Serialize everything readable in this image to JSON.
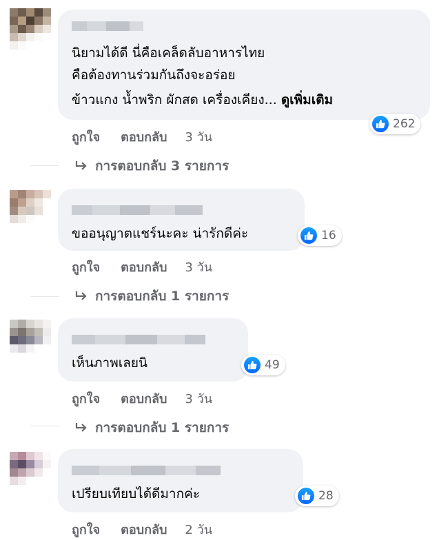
{
  "colors": {
    "bubble": "#f0f2f5",
    "like": "#0866ff",
    "meta": "#65676b"
  },
  "comments": [
    {
      "lines": [
        "นิยามได้ดี นี่คือเคล็ดลับอาหารไทย",
        "คือต้องทานร่วมกันถึงจะอร่อย",
        "ข้าวแกง น้ำพริก ผักสด เครื่องเคียง... "
      ],
      "see_more": "ดูเพิ่มเติม",
      "reactions": "262",
      "like_label": "ถูกใจ",
      "reply_label": "ตอบกลับ",
      "time": "3 วัน",
      "replies": "การตอบกลับ 3 รายการ"
    },
    {
      "lines": [
        "ขออนุญาตแชร์นะคะ น่ารักดีค่ะ"
      ],
      "reactions": "16",
      "like_label": "ถูกใจ",
      "reply_label": "ตอบกลับ",
      "time": "3 วัน",
      "replies": "การตอบกลับ 1 รายการ"
    },
    {
      "lines": [
        "เห็นภาพเลยนิ"
      ],
      "reactions": "49",
      "like_label": "ถูกใจ",
      "reply_label": "ตอบกลับ",
      "time": "3 วัน",
      "replies": "การตอบกลับ 1 รายการ"
    },
    {
      "lines": [
        "เปรียบเทียบได้ดีมากค่ะ"
      ],
      "reactions": "28",
      "like_label": "ถูกใจ",
      "reply_label": "ตอบกลับ",
      "time": "2 วัน"
    }
  ]
}
